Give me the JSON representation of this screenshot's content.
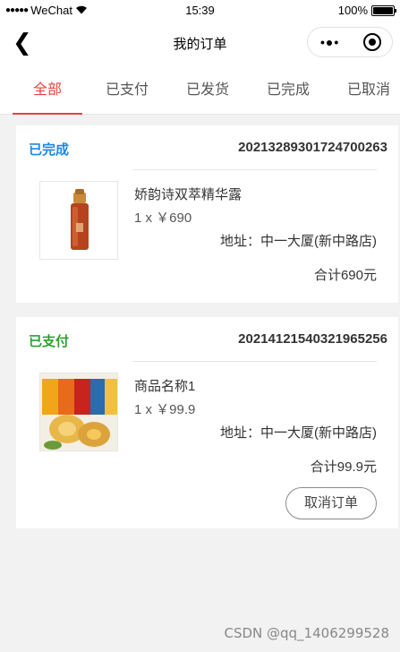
{
  "status_bar": {
    "carrier_dots": "●●●●●",
    "carrier": "WeChat",
    "time": "15:39",
    "battery": "100%",
    "battery_level": 1.0
  },
  "nav": {
    "back_glyph": "❮",
    "title": "我的订单",
    "more_glyph": "•●•"
  },
  "tabs": [
    {
      "label": "全部",
      "active": true
    },
    {
      "label": "已支付",
      "active": false
    },
    {
      "label": "已发货",
      "active": false
    },
    {
      "label": "已完成",
      "active": false
    },
    {
      "label": "已取消",
      "active": false
    }
  ],
  "orders": [
    {
      "status": "已完成",
      "order_no": "20213289301724700263",
      "product_name": "娇韵诗双萃精华露",
      "quantity_price": "1 x ￥690",
      "address": "地址：中一大厦(新中路店)",
      "total": "合计690元"
    },
    {
      "status": "已支付",
      "order_no": "20214121540321965256",
      "product_name": "商品名称1",
      "quantity_price": "1 x ￥99.9",
      "address": "地址：中一大厦(新中路店)",
      "total": "合计99.9元",
      "cancel_label": "取消订单"
    }
  ],
  "watermark": "CSDN @qq_1406299528",
  "colors": {
    "active_tab": "#e64340",
    "status_done": "#1e88e5",
    "status_paid": "#2aa32a"
  }
}
